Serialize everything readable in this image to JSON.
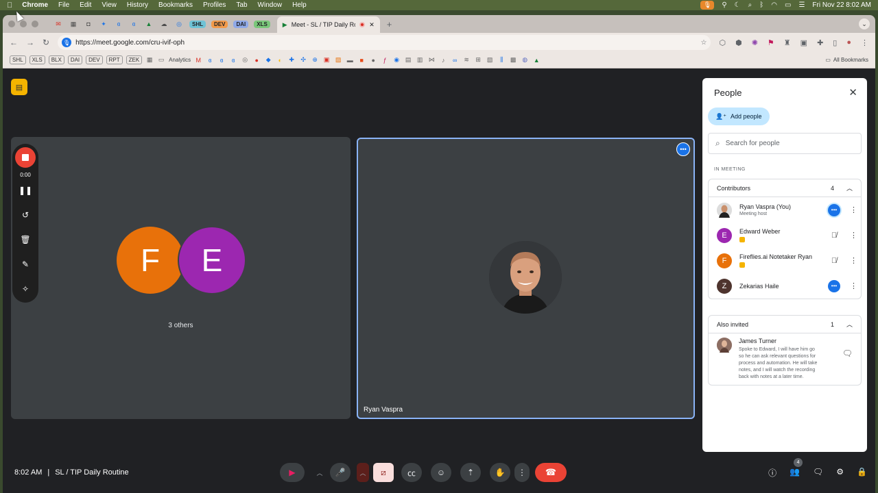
{
  "menubar": {
    "app": "Chrome",
    "menus": [
      "File",
      "Edit",
      "View",
      "History",
      "Bookmarks",
      "Profiles",
      "Tab",
      "Window",
      "Help"
    ],
    "datetime": "Fri Nov 22  8:02 AM"
  },
  "tabs": {
    "chips": [
      "SHL",
      "DEV",
      "DAI",
      "XLS"
    ],
    "active_title": "Meet - SL / TIP Daily Rou"
  },
  "address": {
    "url": "https://meet.google.com/cru-ivif-oph"
  },
  "bookmarks": {
    "chips": [
      "SHL",
      "XLS",
      "BLX",
      "DAI",
      "DEV",
      "RPT",
      "ZEK"
    ],
    "folder": "Analytics",
    "all": "All Bookmarks"
  },
  "recording": {
    "time": "0:00"
  },
  "tiles": {
    "others_label": "3 others",
    "avatar_f": "F",
    "avatar_e": "E",
    "main_name": "Ryan Vaspra"
  },
  "people_panel": {
    "title": "People",
    "add_people": "Add people",
    "search_placeholder": "Search for people",
    "in_meeting": "IN MEETING",
    "contributors_label": "Contributors",
    "contributors_count": "4",
    "contributors": [
      {
        "initial": "",
        "name": "Ryan Vaspra (You)",
        "sub": "Meeting host",
        "color": "#6d4c41"
      },
      {
        "initial": "E",
        "name": "Edward Weber",
        "sub": "",
        "color": "#9c27b0"
      },
      {
        "initial": "F",
        "name": "Fireflies.ai Notetaker Ryan",
        "sub": "",
        "color": "#e8710a"
      },
      {
        "initial": "Z",
        "name": "Zekarias Haile",
        "sub": "",
        "color": "#4e342e"
      }
    ],
    "invited_label": "Also invited",
    "invited_count": "1",
    "invited": {
      "name": "James Turner",
      "note": "Spoke to Edward, I will have him go so he can ask relevant questions for process and automation. He will take notes, and I will watch the recording back with notes at a later time."
    }
  },
  "bottom": {
    "time": "8:02 AM",
    "separator": "|",
    "meeting_name": "SL / TIP Daily Routine",
    "people_count": "4"
  },
  "colors": {
    "accent": "#1a73e8",
    "leave": "#ea4335",
    "avatar_f": "#e8710a",
    "avatar_e": "#9c27b0"
  }
}
